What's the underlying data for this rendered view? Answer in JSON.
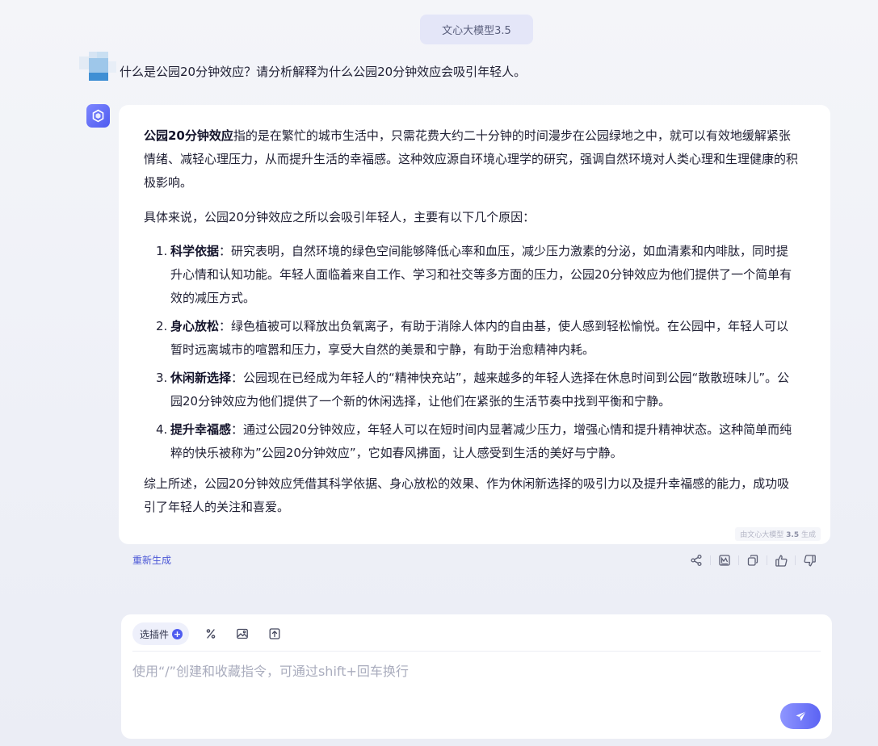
{
  "header": {
    "model_name": "文心大模型3.5"
  },
  "conversation": {
    "user_message": {
      "text": "什么是公园20分钟效应？请分析解释为什么公园20分钟效应会吸引年轻人。"
    },
    "assistant_message": {
      "intro_bold": "公园20分钟效应",
      "intro_text": "指的是在繁忙的城市生活中，只需花费大约二十分钟的时间漫步在公园绿地之中，就可以有效地缓解紧张情绪、减轻心理压力，从而提升生活的幸福感。这种效应源自环境心理学的研究，强调自然环境对人类心理和生理健康的积极影响。",
      "lead_in": "具体来说，公园20分钟效应之所以会吸引年轻人，主要有以下几个原因：",
      "reasons": [
        {
          "num": "1.",
          "title": "科学依据",
          "text": "：研究表明，自然环境的绿色空间能够降低心率和血压，减少压力激素的分泌，如血清素和内啡肽，同时提升心情和认知功能。年轻人面临着来自工作、学习和社交等多方面的压力，公园20分钟效应为他们提供了一个简单有效的减压方式。"
        },
        {
          "num": "2.",
          "title": "身心放松",
          "text": "：绿色植被可以释放出负氧离子，有助于消除人体内的自由基，使人感到轻松愉悦。在公园中，年轻人可以暂时远离城市的喧嚣和压力，享受大自然的美景和宁静，有助于治愈精神内耗。"
        },
        {
          "num": "3.",
          "title": "休闲新选择",
          "text": "：公园现在已经成为年轻人的“精神快充站”，越来越多的年轻人选择在休息时间到公园“散散班味儿”。公园20分钟效应为他们提供了一个新的休闲选择，让他们在紧张的生活节奏中找到平衡和宁静。"
        },
        {
          "num": "4.",
          "title": "提升幸福感",
          "text": "：通过公园20分钟效应，年轻人可以在短时间内显著减少压力，增强心情和提升精神状态。这种简单而纯粹的快乐被称为”公园20分钟效应”，它如春风拂面，让人感受到生活的美好与宁静。"
        }
      ],
      "conclusion": "综上所述，公园20分钟效应凭借其科学依据、身心放松的效果、作为休闲新选择的吸引力以及提升幸福感的能力，成功吸引了年轻人的关注和喜爱。",
      "generated_by_prefix": "由文心大模型 ",
      "generated_by_version": "3.5",
      "generated_by_suffix": " 生成"
    },
    "regenerate_label": "重新生成",
    "action_icons": [
      "share-icon",
      "poster-icon",
      "copy-icon",
      "thumbs-up-icon",
      "thumbs-down-icon"
    ]
  },
  "composer": {
    "plugin_label": "选插件",
    "placeholder": "使用“/”创建和收藏指令，可通过shift+回车换行",
    "value": "",
    "tool_icons": [
      "command-slash-icon",
      "image-upload-icon",
      "file-upload-icon"
    ]
  },
  "colors": {
    "accent": "#4f5cf0",
    "regenerate_link": "#4b57d6",
    "background": "#f1f2f7",
    "card": "#ffffff"
  }
}
